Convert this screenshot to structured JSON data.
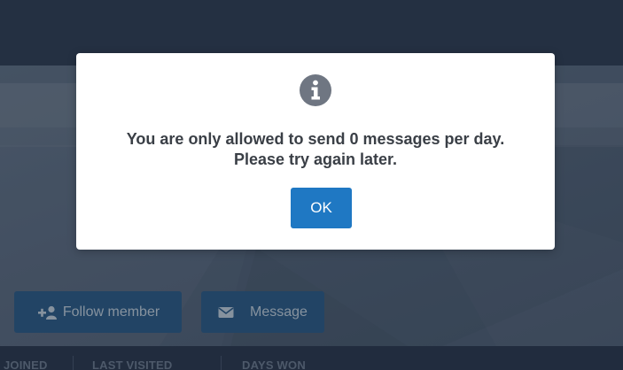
{
  "profile": {
    "follow_button_label": "Follow member",
    "message_button_label": "Message",
    "stats": {
      "joined_label": "JOINED",
      "last_visited_label": "LAST VISITED",
      "days_won_label": "DAYS WON"
    }
  },
  "dialog": {
    "icon": "info-icon",
    "message_line1": "You are only allowed to send 0 messages per day.",
    "message_line2": "Please try again later.",
    "ok_label": "OK"
  },
  "colors": {
    "topbar": "#2d3b51",
    "action_button": "#2a5a86",
    "ok_button": "#1f78c3",
    "info_icon": "#6f7682"
  }
}
